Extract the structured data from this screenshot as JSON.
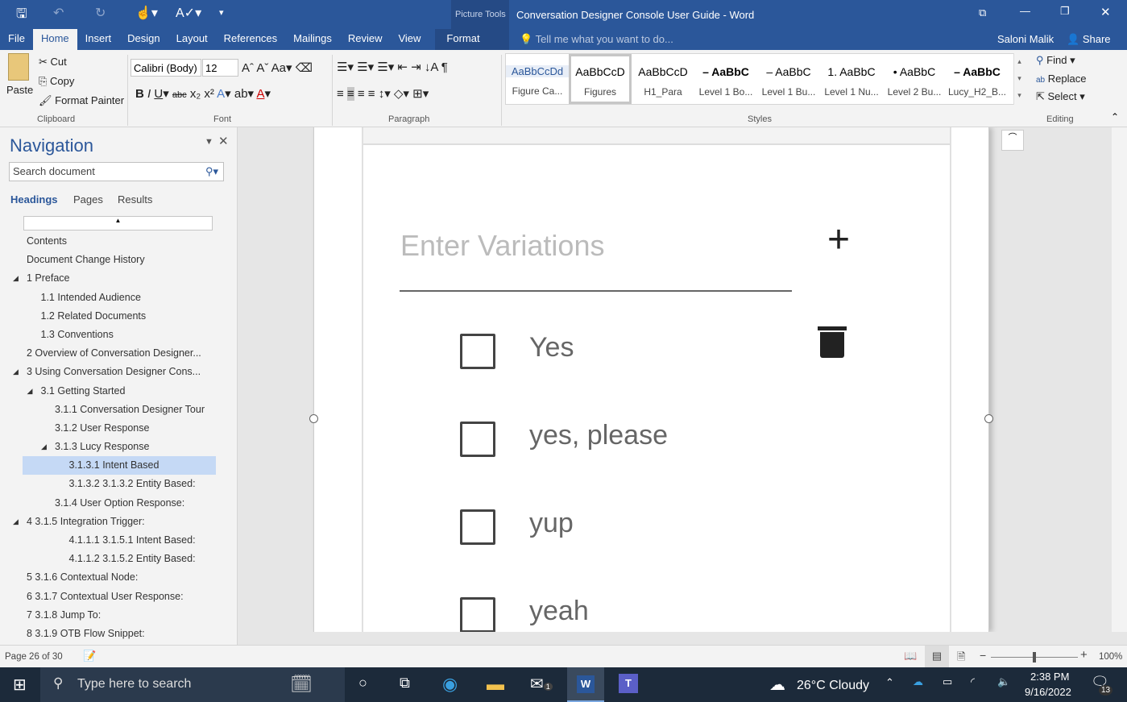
{
  "title_bar": {
    "context": "Picture Tools",
    "title": "Conversation Designer Console User Guide - Word",
    "user": "Saloni Malik",
    "share": "Share",
    "tell_me": "Tell me what you want to do..."
  },
  "tabs": [
    "File",
    "Home",
    "Insert",
    "Design",
    "Layout",
    "References",
    "Mailings",
    "Review",
    "View",
    "Format"
  ],
  "clipboard": {
    "paste": "Paste",
    "cut": "Cut",
    "copy": "Copy",
    "format_painter": "Format Painter",
    "label": "Clipboard"
  },
  "font": {
    "name": "Calibri (Body)",
    "size": "12",
    "label": "Font"
  },
  "paragraph": {
    "label": "Paragraph"
  },
  "styles": {
    "label": "Styles",
    "items": [
      {
        "preview": "AaBbCcDd",
        "name": "Figure Ca..."
      },
      {
        "preview": "AaBbCcD",
        "name": "Figures"
      },
      {
        "preview": "AaBbCcD",
        "name": "H1_Para"
      },
      {
        "preview": "– AaBbC",
        "name": "Level 1 Bo..."
      },
      {
        "preview": "– AaBbC",
        "name": "Level 1 Bu..."
      },
      {
        "preview": "1. AaBbC",
        "name": "Level 1 Nu..."
      },
      {
        "preview": "• AaBbC",
        "name": "Level 2 Bu..."
      },
      {
        "preview": "– AaBbC",
        "name": "Lucy_H2_B..."
      }
    ]
  },
  "editing": {
    "find": "Find",
    "replace": "Replace",
    "select": "Select",
    "label": "Editing"
  },
  "nav": {
    "title": "Navigation",
    "search_placeholder": "Search document",
    "tabs": [
      "Headings",
      "Pages",
      "Results"
    ],
    "headings": [
      {
        "text": "Contents",
        "level": 0
      },
      {
        "text": "Document Change History",
        "level": 0
      },
      {
        "text": "1 Preface",
        "level": 0,
        "expand": true
      },
      {
        "text": "1.1 Intended Audience",
        "level": 1
      },
      {
        "text": "1.2 Related Documents",
        "level": 1
      },
      {
        "text": "1.3 Conventions",
        "level": 1
      },
      {
        "text": "2 Overview of Conversation Designer...",
        "level": 0
      },
      {
        "text": "3  Using Conversation Designer Cons...",
        "level": 0,
        "expand": true
      },
      {
        "text": "3.1 Getting Started",
        "level": 1,
        "expand": true
      },
      {
        "text": "3.1.1 Conversation Designer Tour",
        "level": 2
      },
      {
        "text": "3.1.2 User Response",
        "level": 2
      },
      {
        "text": "3.1.3 Lucy Response",
        "level": 2,
        "expand": true
      },
      {
        "text": "3.1.3.1 Intent Based",
        "level": 3,
        "selected": true
      },
      {
        "text": "3.1.3.2 3.1.3.2 Entity Based:",
        "level": 3
      },
      {
        "text": "3.1.4  User Option Response:",
        "level": 2
      },
      {
        "text": "4 3.1.5 Integration Trigger:",
        "level": 0,
        "expand": true
      },
      {
        "text": "4.1.1.1 3.1.5.1 Intent Based:",
        "level": 3
      },
      {
        "text": "4.1.1.2 3.1.5.2 Entity Based:",
        "level": 3
      },
      {
        "text": "5 3.1.6 Contextual Node:",
        "level": 0
      },
      {
        "text": "6 3.1.7 Contextual User Response:",
        "level": 0
      },
      {
        "text": "7 3.1.8 Jump To:",
        "level": 0
      },
      {
        "text": "8 3.1.9 OTB Flow Snippet:",
        "level": 0
      }
    ]
  },
  "document": {
    "placeholder": "Enter Variations",
    "variations": [
      "Yes",
      "yes, please",
      "yup",
      "yeah"
    ]
  },
  "status": {
    "page": "Page 26 of 30",
    "zoom": "100%",
    "zoom_level": 100
  },
  "taskbar": {
    "search": "Type here to search",
    "weather": "26°C  Cloudy",
    "time": "2:38 PM",
    "date": "9/16/2022",
    "notifications": "13",
    "mail_badge": "1"
  }
}
